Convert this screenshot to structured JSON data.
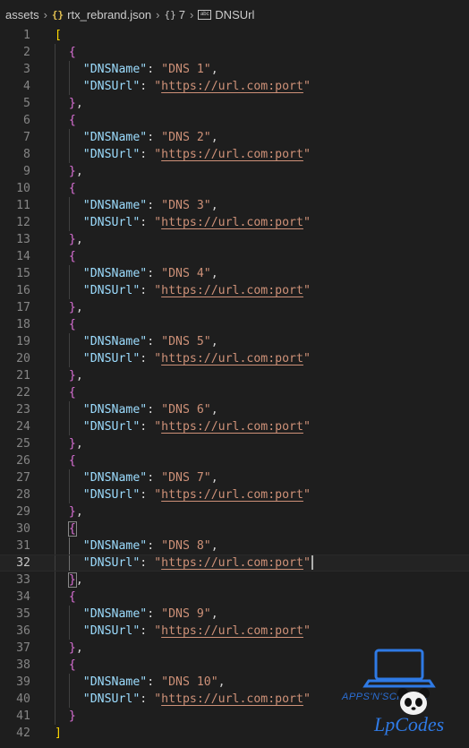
{
  "breadcrumb": {
    "folder": "assets",
    "file": "rtx_rebrand.json",
    "object": "7",
    "property": "DNSUrl",
    "json_icon": "{}",
    "object_icon": "{}",
    "string_icon": "abc"
  },
  "editor": {
    "current_line": 32,
    "open_bracket": "[",
    "close_bracket": "]",
    "entries": [
      {
        "name": "DNS 1",
        "url": "https://url.com:port"
      },
      {
        "name": "DNS 2",
        "url": "https://url.com:port"
      },
      {
        "name": "DNS 3",
        "url": "https://url.com:port"
      },
      {
        "name": "DNS 4",
        "url": "https://url.com:port"
      },
      {
        "name": "DNS 5",
        "url": "https://url.com:port"
      },
      {
        "name": "DNS 6",
        "url": "https://url.com:port"
      },
      {
        "name": "DNS 7",
        "url": "https://url.com:port"
      },
      {
        "name": "DNS 8",
        "url": "https://url.com:port"
      },
      {
        "name": "DNS 9",
        "url": "https://url.com:port"
      },
      {
        "name": "DNS 10",
        "url": "https://url.com:port"
      }
    ],
    "keys": {
      "name_key": "DNSName",
      "url_key": "DNSUrl"
    }
  },
  "watermark": {
    "line1": "APPS'N'SCRIPTS",
    "line2": "LpCodes",
    "icon": "laptop-icon"
  },
  "colors": {
    "background": "#1e1e1e",
    "key": "#9cdcfe",
    "string": "#ce9178",
    "bracket_outer": "#ffd700",
    "bracket_inner": "#da70d6",
    "line_number": "#858585"
  }
}
